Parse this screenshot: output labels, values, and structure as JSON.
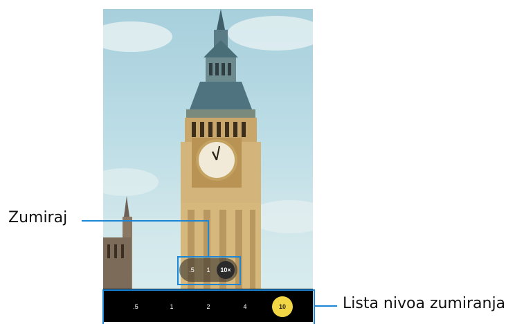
{
  "callouts": {
    "zoom_label": "Zumiraj",
    "zoom_list_label": "Lista nivoa zumiranja"
  },
  "quick_zoom": {
    "options": [
      ".5",
      "1",
      "10×"
    ],
    "active_index": 2
  },
  "zoom_levels": {
    "options": [
      ".5",
      "1",
      "2",
      "4",
      "10"
    ],
    "active_index": 4
  },
  "colors": {
    "highlight": "#1c86d6",
    "active_level": "#f2d544",
    "bar_background": "#000000"
  }
}
